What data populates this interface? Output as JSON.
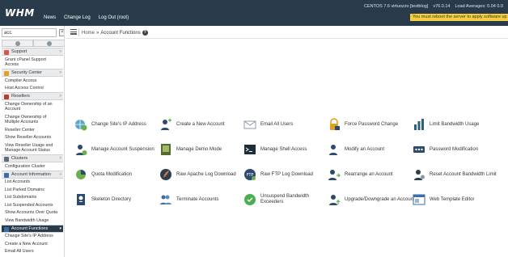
{
  "topbar": {
    "logo": "WHM",
    "nav": [
      "News",
      "Change Log",
      "Log Out (root)"
    ],
    "os": "CENTOS 7.6 virtuozzo [testblog]",
    "version": "v76.0.14",
    "load": "Load Averages: 0.04 0.0",
    "reboot_notice": "You must reboot the server to apply software up"
  },
  "sidebar": {
    "search_value": "acc",
    "clear_label": "×",
    "menu": [
      {
        "type": "cat",
        "label": "Support",
        "icon_color": "#d9534f"
      },
      {
        "type": "item",
        "label": "Grant cPanel Support Access"
      },
      {
        "type": "cat",
        "label": "Security Center",
        "icon_color": "#e0a020"
      },
      {
        "type": "item",
        "label": "Compiler Access"
      },
      {
        "type": "item",
        "label": "Host Access Control"
      },
      {
        "type": "cat",
        "label": "Resellers",
        "icon_color": "#c0392b"
      },
      {
        "type": "item",
        "label": "Change Ownership of an Account"
      },
      {
        "type": "item",
        "label": "Change Ownership of Multiple Accounts"
      },
      {
        "type": "item",
        "label": "Reseller Center"
      },
      {
        "type": "item",
        "label": "Show Reseller Accounts"
      },
      {
        "type": "item",
        "label": "View Reseller Usage and Manage Account Status"
      },
      {
        "type": "cat",
        "label": "Clusters",
        "icon_color": "#5b6b7a"
      },
      {
        "type": "item",
        "label": "Configuration Cluster"
      },
      {
        "type": "cat",
        "label": "Account Information",
        "icon_color": "#3a6ea5"
      },
      {
        "type": "item",
        "label": "List Accounts"
      },
      {
        "type": "item",
        "label": "List Parked Domains"
      },
      {
        "type": "item",
        "label": "List Subdomains"
      },
      {
        "type": "item",
        "label": "List Suspended Accounts"
      },
      {
        "type": "item",
        "label": "Show Accounts Over Quota"
      },
      {
        "type": "item",
        "label": "View Bandwidth Usage"
      },
      {
        "type": "cat",
        "label": "Account Functions",
        "icon_color": "#3a6ea5",
        "active": true
      },
      {
        "type": "item",
        "label": "Change Site's IP Address"
      },
      {
        "type": "item",
        "label": "Create a New Account"
      },
      {
        "type": "item",
        "label": "Email All Users"
      }
    ]
  },
  "breadcrumb": {
    "home": "Home",
    "sep": "»",
    "current": "Account Functions",
    "help": "?"
  },
  "functions": [
    {
      "label": "Change Site's IP Address",
      "icon": "globe-arrows-icon",
      "color": "#4a90b8"
    },
    {
      "label": "Create a New Account",
      "icon": "user-add-icon",
      "color": "#2c4a6e"
    },
    {
      "label": "Email All Users",
      "icon": "envelope-icon",
      "color": "#8a9aa8"
    },
    {
      "label": "Force Password Change",
      "icon": "padlock-icon",
      "color": "#e0a020"
    },
    {
      "label": "Limit Bandwidth Usage",
      "icon": "bar-chart-icon",
      "color": "#2c5f7f"
    },
    {
      "label": "Manage Account Suspension",
      "icon": "user-suspend-icon",
      "color": "#2c4a6e"
    },
    {
      "label": "Manage Demo Mode",
      "icon": "demo-monitor-icon",
      "color": "#556b2f"
    },
    {
      "label": "Manage Shell Access",
      "icon": "terminal-icon",
      "color": "#1f2d3a"
    },
    {
      "label": "Modify an Account",
      "icon": "user-edit-icon",
      "color": "#2c4a6e"
    },
    {
      "label": "Password Modification",
      "icon": "password-dots-icon",
      "color": "#2c4a6e"
    },
    {
      "label": "Quota Modification",
      "icon": "pie-chart-icon",
      "color": "#6ab04c"
    },
    {
      "label": "Raw Apache Log Download",
      "icon": "feather-download-icon",
      "color": "#8b1a1a"
    },
    {
      "label": "Raw FTP Log Download",
      "icon": "ftp-download-icon",
      "color": "#2c4a6e"
    },
    {
      "label": "Rearrange an Account",
      "icon": "user-move-icon",
      "color": "#2c4a6e"
    },
    {
      "label": "Reset Account Bandwidth Limit",
      "icon": "user-reset-icon",
      "color": "#2c3e50"
    },
    {
      "label": "Skeleton Directory",
      "icon": "skeleton-icon",
      "color": "#2c4a6e"
    },
    {
      "label": "Terminate Accounts",
      "icon": "users-remove-icon",
      "color": "#3a6ea5"
    },
    {
      "label": "Unsuspend Bandwidth Exceeders",
      "icon": "unsuspend-icon",
      "color": "#4caf50"
    },
    {
      "label": "Upgrade/Downgrade an Account",
      "icon": "user-upgrade-icon",
      "color": "#2c4a6e"
    },
    {
      "label": "Web Template Editor",
      "icon": "web-template-icon",
      "color": "#3a6ea5"
    }
  ]
}
